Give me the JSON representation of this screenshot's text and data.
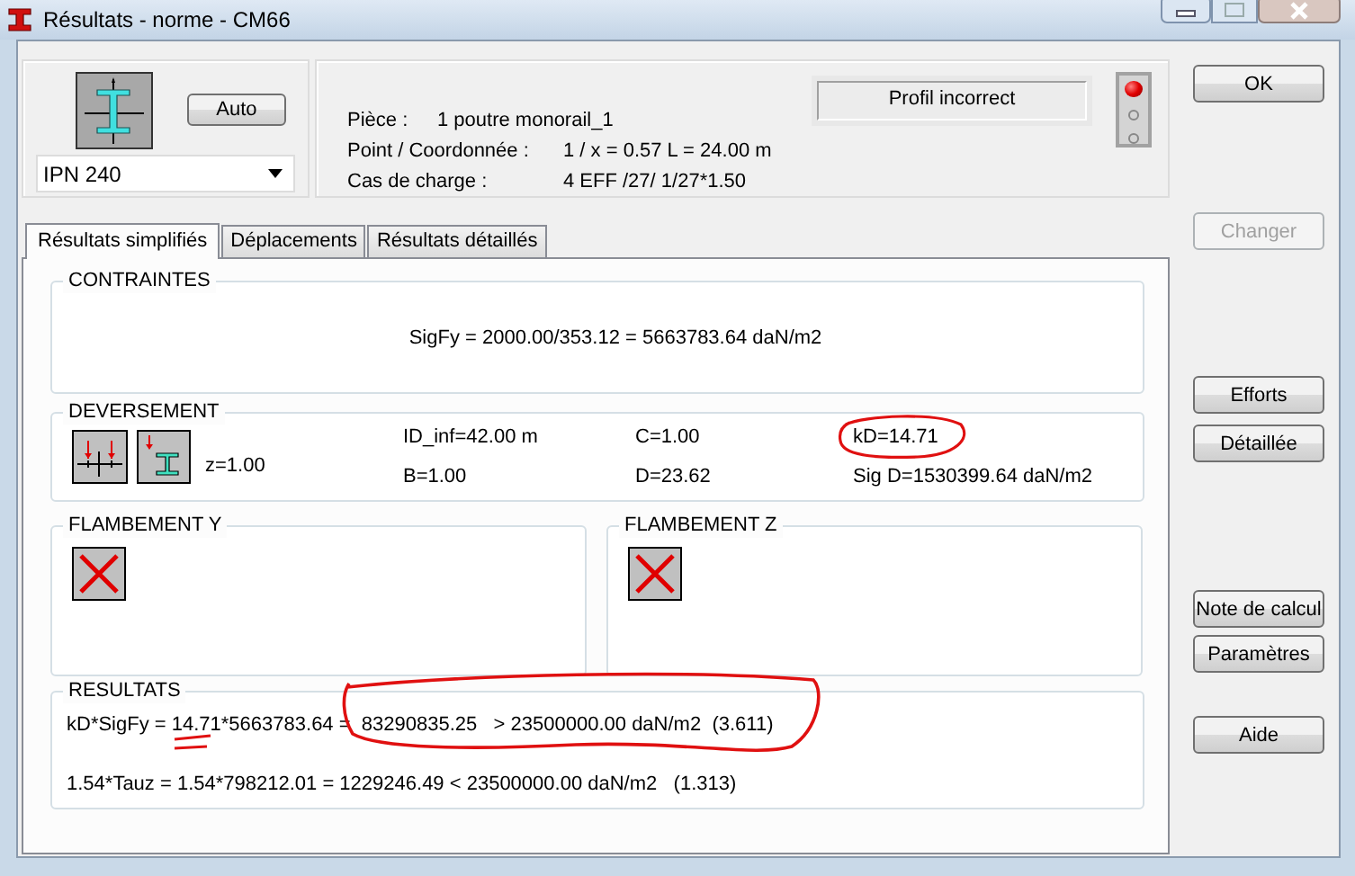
{
  "window": {
    "title": "Résultats - norme - CM66"
  },
  "profile": {
    "auto_button": "Auto",
    "section": "IPN 240"
  },
  "info": {
    "rows": [
      {
        "label": "Pièce :",
        "value": "1  poutre monorail_1"
      },
      {
        "label": "Point / Coordonnée :",
        "value": "1 / x = 0.57 L = 24.00 m"
      },
      {
        "label": "Cas de charge :",
        "value": "4 EFF /27/  1/27*1.50"
      }
    ],
    "status": "Profil incorrect",
    "lights": [
      {
        "on": true
      },
      {
        "on": false
      },
      {
        "on": false
      }
    ]
  },
  "tabs": [
    {
      "label": "Résultats simplifiés",
      "selected": true
    },
    {
      "label": "Déplacements",
      "selected": false
    },
    {
      "label": "Résultats détaillés",
      "selected": false
    }
  ],
  "contraintes": {
    "title": "CONTRAINTES",
    "text": "SigFy = 2000.00/353.12 = 5663783.64 daN/m2"
  },
  "deversement": {
    "title": "DEVERSEMENT",
    "z": "z=1.00",
    "values": [
      [
        "ID_inf=42.00 m",
        "C=1.00",
        "kD=14.71"
      ],
      [
        "B=1.00",
        "D=23.62",
        "Sig D=1530399.64 daN/m2"
      ]
    ]
  },
  "flambement": [
    {
      "title": "FLAMBEMENT Y"
    },
    {
      "title": "FLAMBEMENT Z"
    }
  ],
  "resultats": {
    "title": "RESULTATS",
    "lines": [
      "kD*SigFy = 14.71*5663783.64 =  83290835.25   > 23500000.00 daN/m2  (3.611)",
      "1.54*Tauz = 1.54*798212.01 = 1229246.49 < 23500000.00 daN/m2   (1.313)"
    ]
  },
  "buttons": [
    {
      "label": "OK",
      "disabled": false
    },
    {
      "label": "Changer",
      "disabled": true
    },
    {
      "label": "Efforts",
      "disabled": false
    },
    {
      "label": "Détaillée",
      "disabled": false
    },
    {
      "label": "Note de calcul",
      "disabled": false
    },
    {
      "label": "Paramètres",
      "disabled": false
    },
    {
      "label": "Aide",
      "disabled": false
    }
  ]
}
